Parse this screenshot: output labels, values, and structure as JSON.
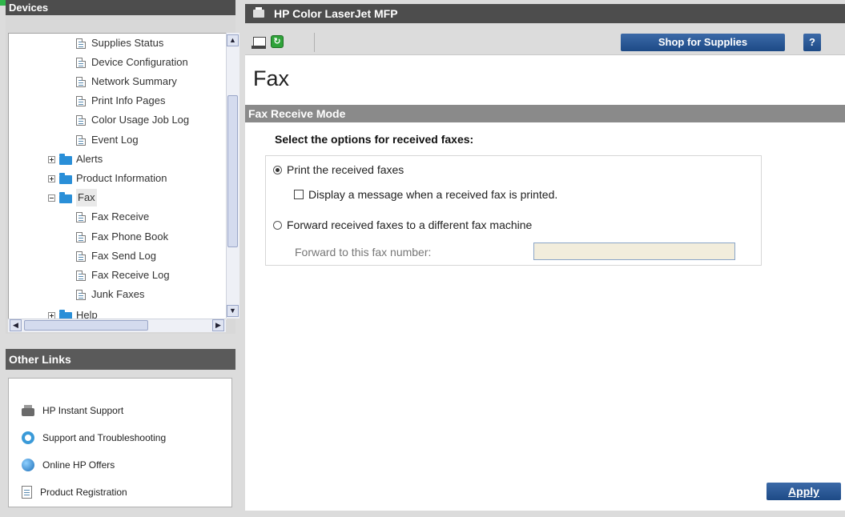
{
  "devices": {
    "title": "Devices",
    "tree": [
      {
        "label": "Supplies Status",
        "type": "page"
      },
      {
        "label": "Device Configuration",
        "type": "page"
      },
      {
        "label": "Network Summary",
        "type": "page"
      },
      {
        "label": "Print Info Pages",
        "type": "page"
      },
      {
        "label": "Color Usage Job Log",
        "type": "page"
      },
      {
        "label": "Event Log",
        "type": "page"
      },
      {
        "label": "Alerts",
        "type": "folder",
        "state": "collapsed"
      },
      {
        "label": "Product Information",
        "type": "folder",
        "state": "collapsed"
      },
      {
        "label": "Fax",
        "type": "folder",
        "state": "expanded"
      },
      {
        "label": "Fax Receive",
        "type": "page"
      },
      {
        "label": "Fax Phone Book",
        "type": "page"
      },
      {
        "label": "Fax Send Log",
        "type": "page"
      },
      {
        "label": "Fax Receive Log",
        "type": "page"
      },
      {
        "label": "Junk Faxes",
        "type": "page"
      },
      {
        "label": "Help",
        "type": "folder",
        "state": "collapsed"
      }
    ]
  },
  "other_links": {
    "title": "Other Links",
    "items": [
      {
        "label": "HP Instant Support",
        "icon": "printer-icon"
      },
      {
        "label": "Support and Troubleshooting",
        "icon": "lifering-icon"
      },
      {
        "label": "Online HP Offers",
        "icon": "globe-icon"
      },
      {
        "label": "Product Registration",
        "icon": "document-icon"
      }
    ]
  },
  "header": {
    "title": "HP Color LaserJet MFP",
    "shop_label": "Shop for Supplies",
    "help_label": "?"
  },
  "page": {
    "title": "Fax",
    "section": "Fax Receive Mode",
    "instructions": "Select the options for received faxes:",
    "options": {
      "print_label": "Print the received faxes",
      "print_selected": true,
      "display_msg_label": "Display a message when a received fax is printed.",
      "display_msg_checked": false,
      "forward_label": "Forward received faxes to a different fax machine",
      "forward_selected": false,
      "forward_number_label": "Forward to this fax number:",
      "forward_number_value": ""
    },
    "apply_label": "Apply"
  },
  "colors": {
    "header_bg": "#4d4d4d",
    "section_bg": "#8a8a8a",
    "button_blue": "#2a5796",
    "accent_green": "#2fb64a",
    "input_bg": "#f2eddc"
  }
}
